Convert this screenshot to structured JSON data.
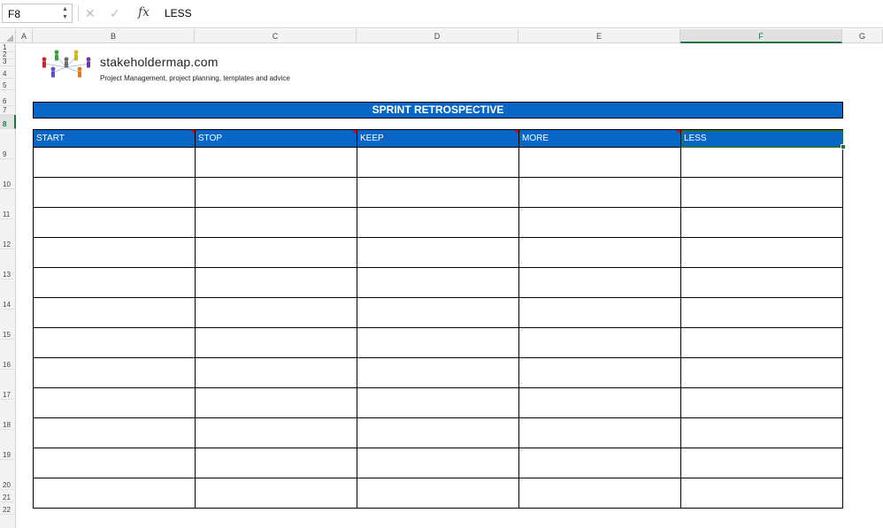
{
  "formula_bar": {
    "name_box": "F8",
    "cancel_icon": "close-icon",
    "enter_icon": "check-icon",
    "fx_label": "fx",
    "formula_value": "LESS"
  },
  "columns": [
    "A",
    "B",
    "C",
    "D",
    "E",
    "F",
    "G"
  ],
  "active_column": "F",
  "rows": [
    "1",
    "2",
    "3",
    "4",
    "5",
    "6",
    "7",
    "8",
    "9",
    "10",
    "11",
    "12",
    "13",
    "14",
    "15",
    "16",
    "17",
    "18",
    "19",
    "20",
    "21",
    "22"
  ],
  "active_row": "8",
  "logo": {
    "title": "stakeholdermap.com",
    "tagline": "Project Management, project planning, templates and advice"
  },
  "sheet": {
    "title": "SPRINT RETROSPECTIVE",
    "headers": [
      "START",
      "STOP",
      "KEEP",
      "MORE",
      "LESS"
    ],
    "selected_header_index": 4,
    "body_rows": 12
  },
  "colors": {
    "header_blue": "#0866c6",
    "selection_green": "#217346",
    "comment_red": "#d9001b"
  }
}
